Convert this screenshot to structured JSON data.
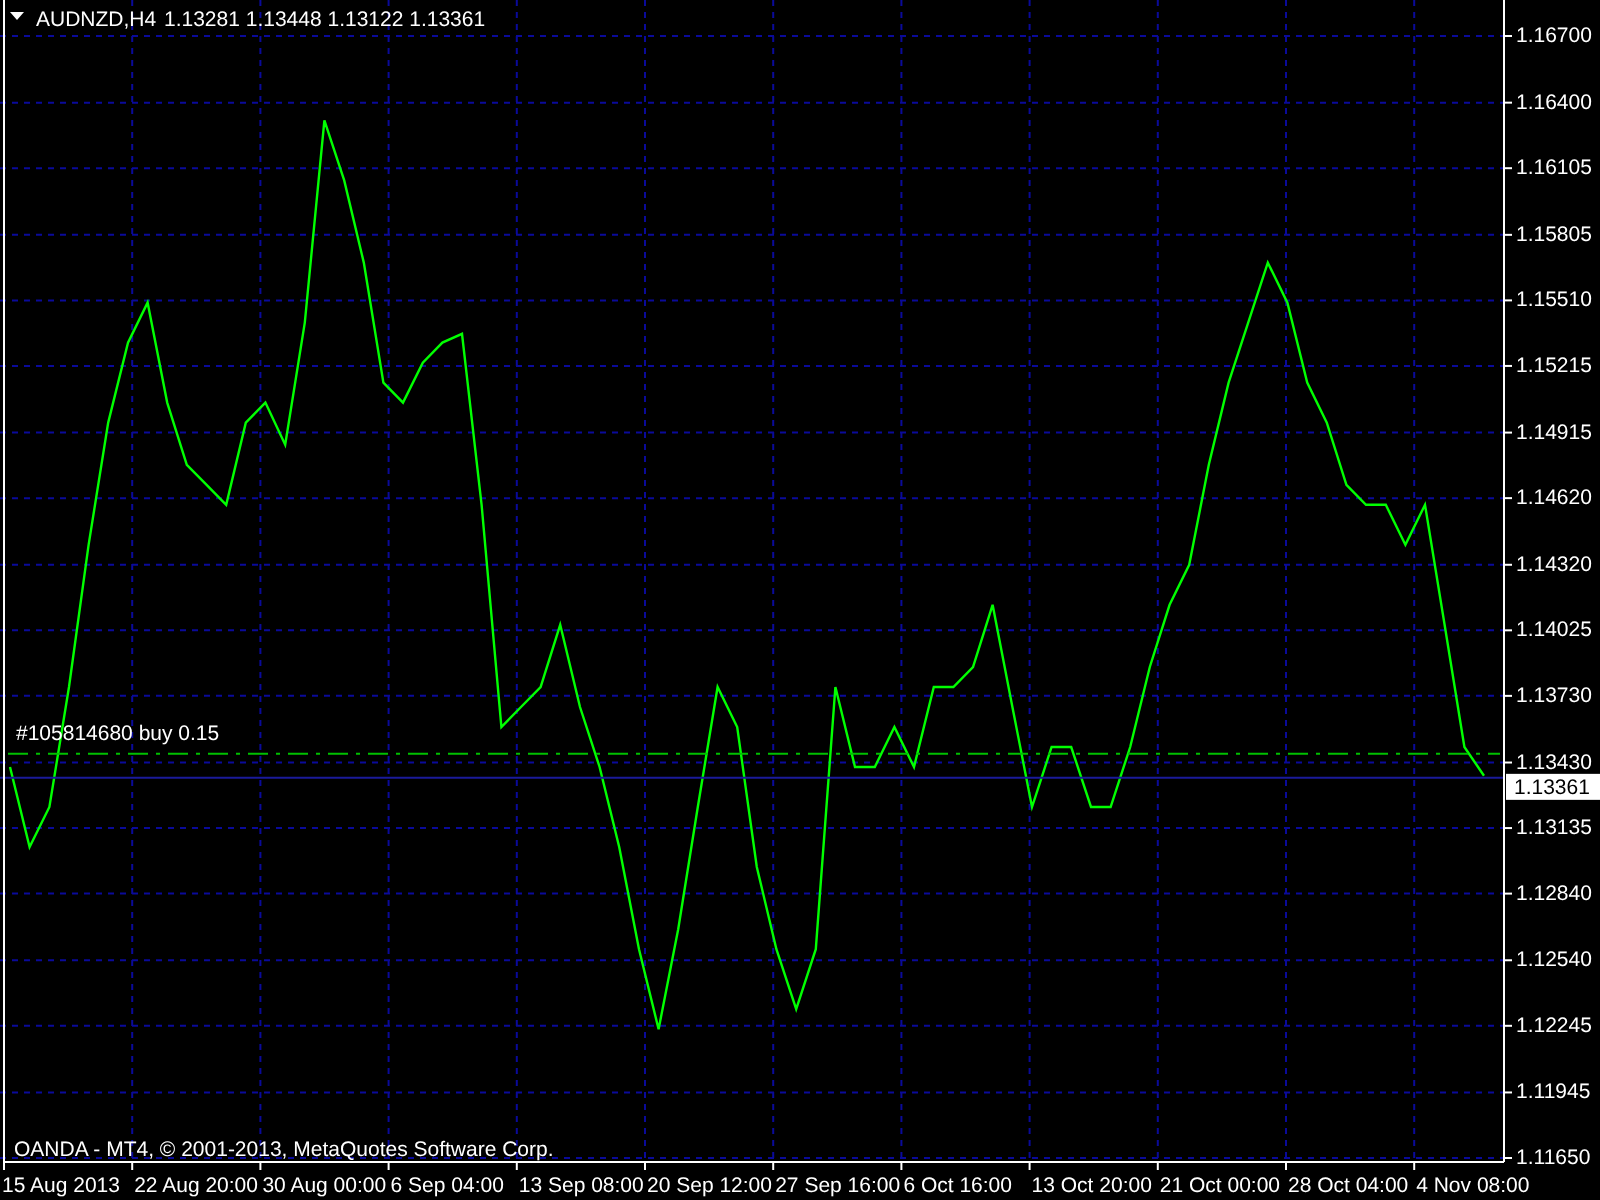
{
  "header": {
    "symbol": "AUDNZD,H4",
    "quotes": "1.13281 1.13448 1.13122 1.13361"
  },
  "chart": {
    "chart_data": {
      "type": "line",
      "grid": true,
      "series": [
        {
          "color": "#00ff00",
          "values": [
            1.1341,
            1.1305,
            1.1323,
            1.1377,
            1.1441,
            1.1496,
            1.1532,
            1.155,
            1.1505,
            1.1477,
            1.1468,
            1.1459,
            1.1496,
            1.1505,
            1.1486,
            1.1541,
            1.1632,
            1.1605,
            1.1568,
            1.1514,
            1.1505,
            1.1523,
            1.1532,
            1.1536,
            1.1459,
            1.1359,
            1.1368,
            1.1377,
            1.1405,
            1.1368,
            1.1341,
            1.1305,
            1.1259,
            1.1223,
            1.1268,
            1.1323,
            1.1377,
            1.1359,
            1.1296,
            1.1259,
            1.1232,
            1.1259,
            1.1377,
            1.1341,
            1.1341,
            1.1359,
            1.1341,
            1.1377,
            1.1377,
            1.1386,
            1.1414,
            1.1368,
            1.1323,
            1.135,
            1.135,
            1.1323,
            1.1323,
            1.135,
            1.1386,
            1.1414,
            1.1432,
            1.1477,
            1.1514,
            1.1541,
            1.1568,
            1.155,
            1.1514,
            1.1496,
            1.1468,
            1.1459,
            1.1459,
            1.1441,
            1.1459,
            1.1405,
            1.135,
            1.1337
          ]
        }
      ],
      "ylim": [
        1.1165,
        1.167
      ],
      "yticks": [
        {
          "value": 1.167,
          "label": "1.16700"
        },
        {
          "value": 1.164,
          "label": "1.16400"
        },
        {
          "value": 1.16105,
          "label": "1.16105"
        },
        {
          "value": 1.15805,
          "label": "1.15805"
        },
        {
          "value": 1.1551,
          "label": "1.15510"
        },
        {
          "value": 1.15215,
          "label": "1.15215"
        },
        {
          "value": 1.14915,
          "label": "1.14915"
        },
        {
          "value": 1.1462,
          "label": "1.14620"
        },
        {
          "value": 1.1432,
          "label": "1.14320"
        },
        {
          "value": 1.14025,
          "label": "1.14025"
        },
        {
          "value": 1.1373,
          "label": "1.13730"
        },
        {
          "value": 1.1343,
          "label": "1.13430"
        },
        {
          "value": 1.13135,
          "label": "1.13135"
        },
        {
          "value": 1.1284,
          "label": "1.12840"
        },
        {
          "value": 1.1254,
          "label": "1.12540"
        },
        {
          "value": 1.12245,
          "label": "1.12245"
        },
        {
          "value": 1.11945,
          "label": "1.11945"
        },
        {
          "value": 1.1165,
          "label": "1.11650"
        }
      ],
      "ref_lines": [
        {
          "axis": "y",
          "value": 1.1347,
          "label": "#105814680 buy 0.15",
          "color": "#00c000"
        },
        {
          "axis": "y",
          "value": 1.13361,
          "label": "1.13361",
          "color": "#1a1a9a"
        }
      ]
    },
    "time_axis": [
      "15 Aug 2013",
      "22 Aug 20:00",
      "30 Aug 00:00",
      "6 Sep 04:00",
      "13 Sep 08:00",
      "20 Sep 12:00",
      "27 Sep 16:00",
      "6 Oct 16:00",
      "13 Oct 20:00",
      "21 Oct 00:00",
      "28 Oct 04:00",
      "4 Nov 08:00"
    ]
  },
  "copyright": "OANDA - MT4, © 2001-2013, MetaQuotes Software Corp."
}
